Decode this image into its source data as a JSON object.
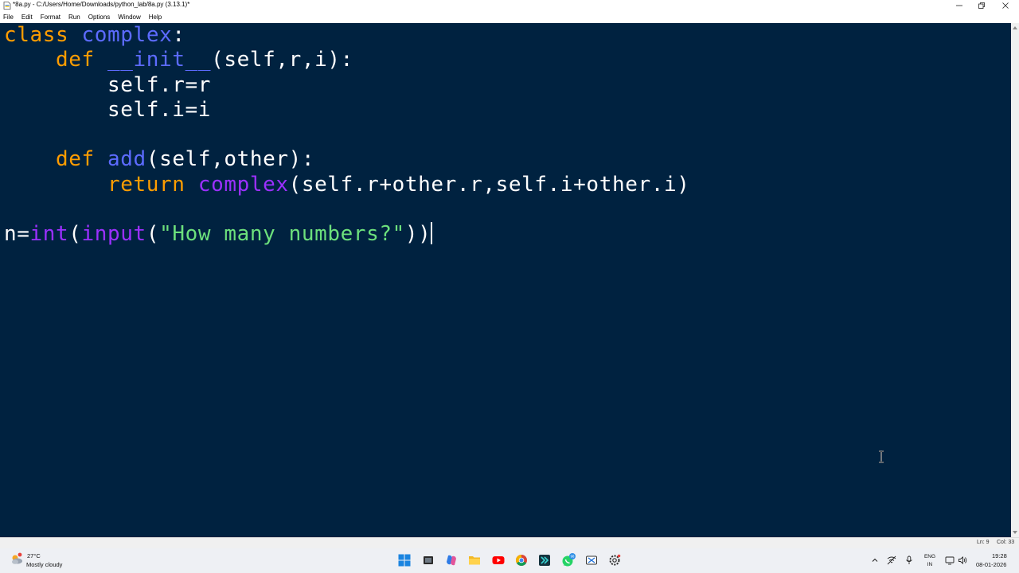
{
  "window": {
    "title": "*8a.py - C:/Users/Home/Downloads/python_lab/8a.py (3.13.1)*"
  },
  "menu": [
    {
      "label": "File"
    },
    {
      "label": "Edit"
    },
    {
      "label": "Format"
    },
    {
      "label": "Run"
    },
    {
      "label": "Options"
    },
    {
      "label": "Window"
    },
    {
      "label": "Help"
    }
  ],
  "editor": {
    "background": "#002240",
    "lines": [
      {
        "indent": "",
        "tokens": [
          [
            "kw",
            "class"
          ],
          [
            "t",
            " "
          ],
          [
            "def",
            "complex"
          ],
          [
            "t",
            ":"
          ]
        ]
      },
      {
        "indent": "    ",
        "tokens": [
          [
            "kw",
            "def"
          ],
          [
            "t",
            " "
          ],
          [
            "def",
            "__init__"
          ],
          [
            "t",
            "(self,r,i):"
          ]
        ]
      },
      {
        "indent": "        ",
        "tokens": [
          [
            "t",
            "self.r=r"
          ]
        ]
      },
      {
        "indent": "        ",
        "tokens": [
          [
            "t",
            "self.i=i"
          ]
        ]
      },
      {
        "indent": "",
        "tokens": []
      },
      {
        "indent": "    ",
        "tokens": [
          [
            "kw",
            "def"
          ],
          [
            "t",
            " "
          ],
          [
            "def",
            "add"
          ],
          [
            "t",
            "(self,other):"
          ]
        ]
      },
      {
        "indent": "        ",
        "tokens": [
          [
            "kw",
            "return"
          ],
          [
            "t",
            " "
          ],
          [
            "blt",
            "complex"
          ],
          [
            "t",
            "(self.r+other.r,self.i+other.i)"
          ]
        ]
      },
      {
        "indent": "",
        "tokens": []
      },
      {
        "indent": "",
        "tokens": [
          [
            "t",
            "n="
          ],
          [
            "blt",
            "int"
          ],
          [
            "t",
            "("
          ],
          [
            "blt",
            "input"
          ],
          [
            "t",
            "("
          ],
          [
            "str",
            "\"How many numbers?\""
          ],
          [
            "t",
            "))"
          ]
        ],
        "cursor": true
      }
    ]
  },
  "status": {
    "line": "Ln: 9",
    "col": "Col: 33"
  },
  "taskbar": {
    "weather_temp": "27°C",
    "weather_desc": "Mostly cloudy",
    "lang_top": "ENG",
    "lang_bottom": "IN",
    "time": "19:28",
    "date": "08-01-2026",
    "whatsapp_badge": "98"
  },
  "colors": {
    "keyword": "#ff9d00",
    "definition": "#5c6bff",
    "builtin": "#9b30ff",
    "string": "#6ce07c",
    "text": "#ffffff"
  }
}
